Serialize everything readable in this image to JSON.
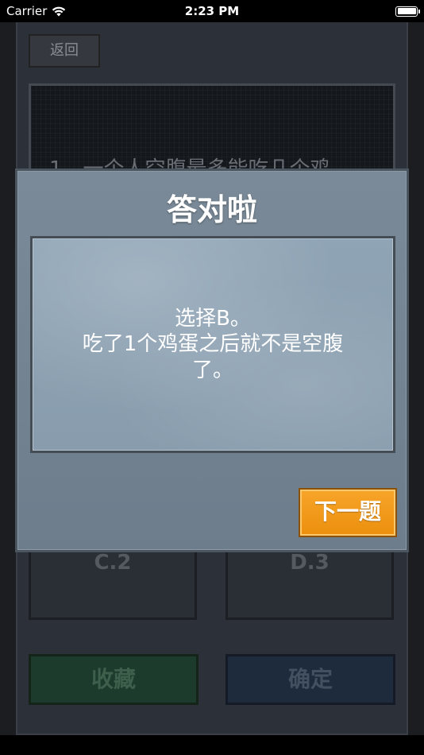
{
  "status_bar": {
    "carrier": "Carrier",
    "time": "2:23 PM",
    "wifi_icon": "wifi-icon",
    "battery_icon": "battery-icon"
  },
  "background": {
    "back_label": "返回",
    "question_text": "1、一个人空腹最多能吃几个鸡",
    "options": {
      "c": "C.2",
      "d": "D.3"
    },
    "favorite_label": "收藏",
    "confirm_label": "确定"
  },
  "modal": {
    "title": "答对啦",
    "message_lines": [
      "选择B。",
      "吃了1个鸡蛋之后就不是空腹",
      "了。"
    ],
    "next_label": "下一题"
  },
  "colors": {
    "next_button": "#ef950f",
    "modal_bg": "#7585942",
    "app_bg": "#2c3038"
  }
}
